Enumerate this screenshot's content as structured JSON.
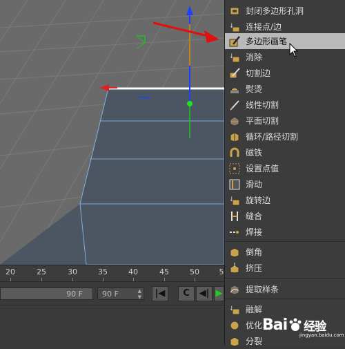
{
  "viewport": {
    "description_icons": [
      "move-axis-gizmo",
      "polygon-mesh"
    ]
  },
  "timeline": {
    "ticks": [
      "20",
      "25",
      "30",
      "35",
      "40",
      "45",
      "50",
      "5"
    ],
    "end_frame_value": "90 F",
    "end_frame_field": "90 F"
  },
  "menu": {
    "items": [
      {
        "label": "封闭多边形孔洞",
        "icon": "close-polygon-hole-icon"
      },
      {
        "label": "连接点/边",
        "icon": "connect-points-edges-icon"
      },
      {
        "label": "多边形画笔",
        "icon": "polygon-pen-icon"
      },
      {
        "label": "消除",
        "icon": "dissolve-icon"
      },
      {
        "label": "切割边",
        "icon": "edge-cut-icon"
      },
      {
        "label": "熨烫",
        "icon": "iron-icon"
      },
      {
        "label": "线性切割",
        "icon": "line-cut-icon"
      },
      {
        "label": "平面切割",
        "icon": "plane-cut-icon"
      },
      {
        "label": "循环/路径切割",
        "icon": "loop-path-cut-icon"
      },
      {
        "label": "磁铁",
        "icon": "magnet-icon"
      },
      {
        "label": "设置点值",
        "icon": "set-point-value-icon"
      },
      {
        "label": "滑动",
        "icon": "slide-icon"
      },
      {
        "label": "旋转边",
        "icon": "spin-edge-icon"
      },
      {
        "label": "缝合",
        "icon": "stitch-icon"
      },
      {
        "label": "焊接",
        "icon": "weld-icon"
      },
      {
        "label": "倒角",
        "icon": "bevel-icon"
      },
      {
        "label": "挤压",
        "icon": "extrude-icon"
      },
      {
        "label": "提取样条",
        "icon": "extract-spline-icon"
      },
      {
        "label": "融解",
        "icon": "melt-icon"
      },
      {
        "label": "优化...",
        "icon": "optimize-icon"
      },
      {
        "label": "分裂",
        "icon": "split-icon"
      }
    ],
    "highlighted_index": 2
  },
  "watermark": {
    "text": "Bai",
    "text2": "经验",
    "sub": "jingyan.baidu.com"
  },
  "colors": {
    "viewport_bg": "#6a6a6a",
    "polygon_fill": "#4b5563",
    "polygon_edge": "#7fa4d4",
    "axis_x": "#e02020",
    "axis_y": "#20c020",
    "axis_z": "#2040ff",
    "annotation_arrow": "#e01010",
    "menu_highlight": "#b9b9b9"
  }
}
